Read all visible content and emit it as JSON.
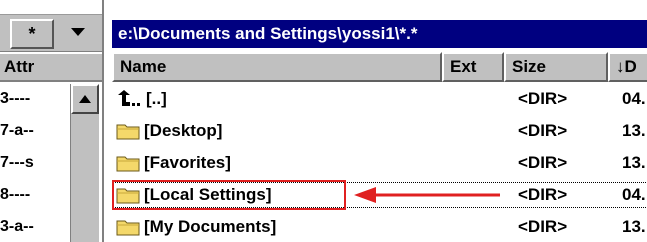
{
  "toolbar": {
    "star_label": "*"
  },
  "path": "e:\\Documents and Settings\\yossi1\\*.*",
  "left_header": "Attr",
  "attrs": [
    "3----",
    "7-a--",
    "7---s",
    "8----",
    "3-a--"
  ],
  "columns": {
    "name": "Name",
    "ext": "Ext",
    "size": "Size",
    "date": "↓D"
  },
  "rows": [
    {
      "name": "[..]",
      "size": "<DIR>",
      "date": "04."
    },
    {
      "name": "[Desktop]",
      "size": "<DIR>",
      "date": "13."
    },
    {
      "name": "[Favorites]",
      "size": "<DIR>",
      "date": "13."
    },
    {
      "name": "[Local Settings]",
      "size": "<DIR>",
      "date": "04."
    },
    {
      "name": "[My Documents]",
      "size": "<DIR>",
      "date": "13."
    }
  ],
  "icons": {
    "up": "up-directory-icon",
    "folder": "folder-icon",
    "dropdown": "dropdown-arrow-icon",
    "scroll_up": "scroll-up-arrow-icon"
  },
  "colors": {
    "path_bar_bg": "#000080",
    "highlight_box": "#e02020",
    "arrow": "#e02020",
    "folder_fill": "#f4d86a"
  }
}
